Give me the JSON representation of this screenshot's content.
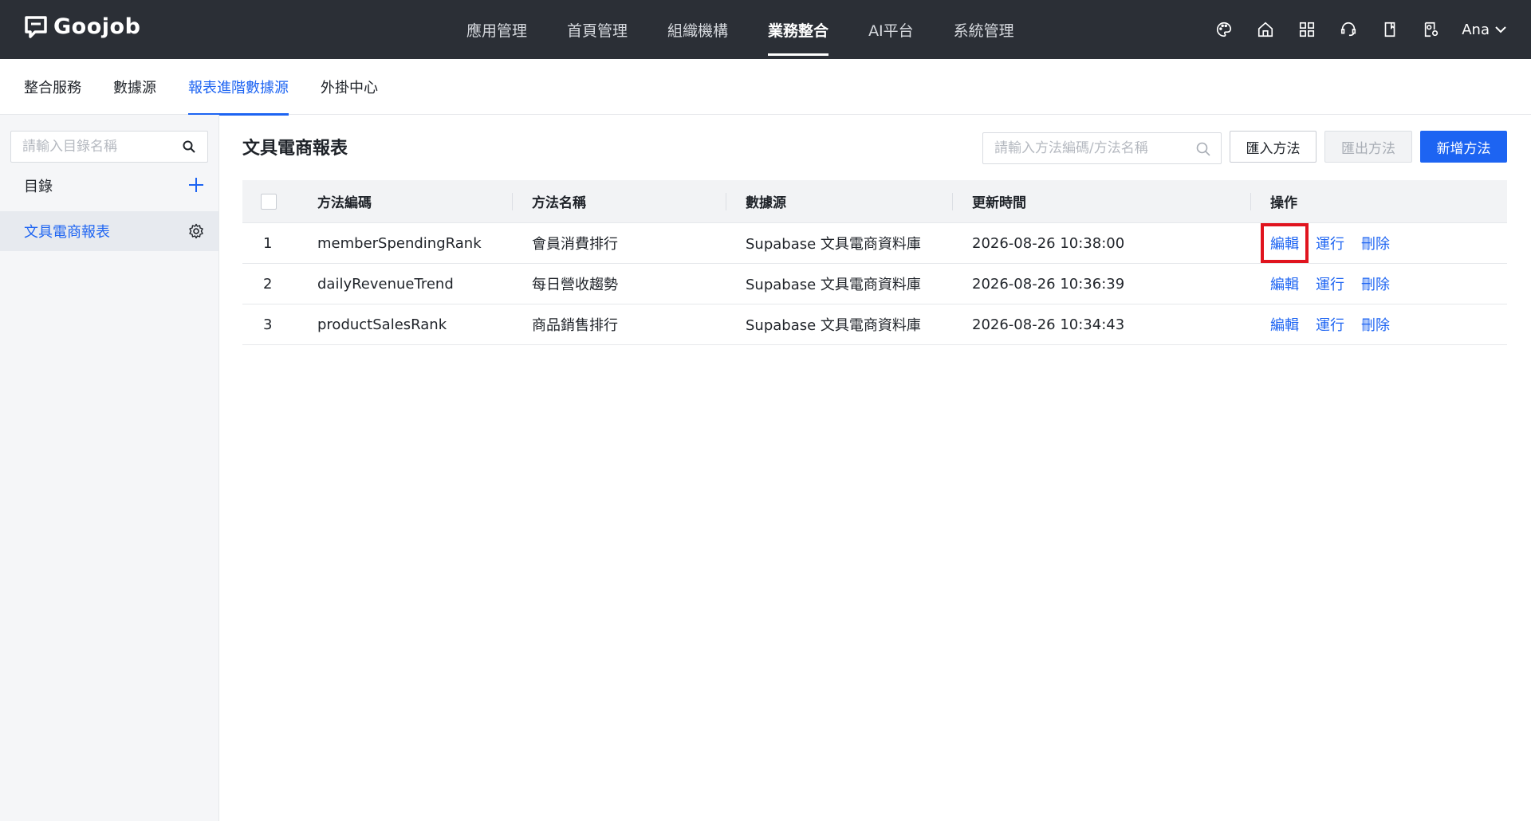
{
  "app": {
    "logo_text": "Goojob"
  },
  "top_nav": {
    "items": [
      {
        "label": "應用管理",
        "active": false
      },
      {
        "label": "首頁管理",
        "active": false
      },
      {
        "label": "組織機構",
        "active": false
      },
      {
        "label": "業務整合",
        "active": true
      },
      {
        "label": "AI平台",
        "active": false
      },
      {
        "label": "系統管理",
        "active": false
      }
    ],
    "icons": [
      "palette-icon",
      "home-icon",
      "apps-grid-icon",
      "support-icon",
      "book-icon",
      "user-settings-icon"
    ],
    "user": {
      "name": "Ana"
    }
  },
  "sub_tabs": [
    {
      "label": "整合服務",
      "active": false
    },
    {
      "label": "數據源",
      "active": false
    },
    {
      "label": "報表進階數據源",
      "active": true
    },
    {
      "label": "外掛中心",
      "active": false
    }
  ],
  "sidebar": {
    "search_placeholder": "請輸入目錄名稱",
    "directory_label": "目錄",
    "tree_items": [
      {
        "label": "文具電商報表",
        "selected": true
      }
    ]
  },
  "main": {
    "title": "文具電商報表",
    "search_placeholder": "請輸入方法編碼/方法名稱",
    "buttons": {
      "import": "匯入方法",
      "export": "匯出方法",
      "add": "新增方法"
    },
    "table": {
      "headers": {
        "code": "方法編碼",
        "name": "方法名稱",
        "source": "數據源",
        "updated": "更新時間",
        "ops": "操作"
      },
      "rows": [
        {
          "index": "1",
          "code": "memberSpendingRank",
          "name": "會員消費排行",
          "source": "Supabase 文具電商資料庫",
          "updated": "2026-08-26 10:38:00"
        },
        {
          "index": "2",
          "code": "dailyRevenueTrend",
          "name": "每日營收趨勢",
          "source": "Supabase 文具電商資料庫",
          "updated": "2026-08-26 10:36:39"
        },
        {
          "index": "3",
          "code": "productSalesRank",
          "name": "商品銷售排行",
          "source": "Supabase 文具電商資料庫",
          "updated": "2026-08-26 10:34:43"
        }
      ],
      "ops": {
        "edit": "編輯",
        "run": "運行",
        "delete": "刪除"
      }
    }
  },
  "colors": {
    "primary": "#1d64f2",
    "topbar": "#2b2f36",
    "highlight": "#e0141e"
  }
}
